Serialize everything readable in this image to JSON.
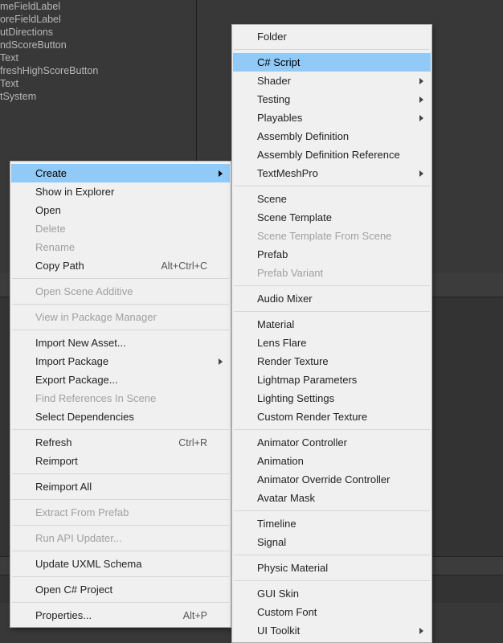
{
  "hierarchy": {
    "items": [
      "meFieldLabel",
      "oreFieldLabel",
      "utDirections",
      "ndScoreButton",
      "Text",
      "freshHighScoreButton",
      "Text",
      "tSystem"
    ]
  },
  "contextMenu": {
    "items": [
      {
        "label": "Create",
        "submenu": true,
        "highlight": true
      },
      {
        "label": "Show in Explorer"
      },
      {
        "label": "Open"
      },
      {
        "label": "Delete",
        "disabled": true
      },
      {
        "label": "Rename",
        "disabled": true
      },
      {
        "label": "Copy Path",
        "shortcut": "Alt+Ctrl+C"
      },
      {
        "sep": true
      },
      {
        "label": "Open Scene Additive",
        "disabled": true
      },
      {
        "sep": true
      },
      {
        "label": "View in Package Manager",
        "disabled": true
      },
      {
        "sep": true
      },
      {
        "label": "Import New Asset..."
      },
      {
        "label": "Import Package",
        "submenu": true
      },
      {
        "label": "Export Package..."
      },
      {
        "label": "Find References In Scene",
        "disabled": true
      },
      {
        "label": "Select Dependencies"
      },
      {
        "sep": true
      },
      {
        "label": "Refresh",
        "shortcut": "Ctrl+R"
      },
      {
        "label": "Reimport"
      },
      {
        "sep": true
      },
      {
        "label": "Reimport All"
      },
      {
        "sep": true
      },
      {
        "label": "Extract From Prefab",
        "disabled": true
      },
      {
        "sep": true
      },
      {
        "label": "Run API Updater...",
        "disabled": true
      },
      {
        "sep": true
      },
      {
        "label": "Update UXML Schema"
      },
      {
        "sep": true
      },
      {
        "label": "Open C# Project"
      },
      {
        "sep": true
      },
      {
        "label": "Properties...",
        "shortcut": "Alt+P"
      }
    ]
  },
  "createSubmenu": {
    "items": [
      {
        "label": "Folder"
      },
      {
        "sep": true
      },
      {
        "label": "C# Script",
        "highlight": true
      },
      {
        "label": "Shader",
        "submenu": true
      },
      {
        "label": "Testing",
        "submenu": true
      },
      {
        "label": "Playables",
        "submenu": true
      },
      {
        "label": "Assembly Definition"
      },
      {
        "label": "Assembly Definition Reference"
      },
      {
        "label": "TextMeshPro",
        "submenu": true
      },
      {
        "sep": true
      },
      {
        "label": "Scene"
      },
      {
        "label": "Scene Template"
      },
      {
        "label": "Scene Template From Scene",
        "disabled": true
      },
      {
        "label": "Prefab"
      },
      {
        "label": "Prefab Variant",
        "disabled": true
      },
      {
        "sep": true
      },
      {
        "label": "Audio Mixer"
      },
      {
        "sep": true
      },
      {
        "label": "Material"
      },
      {
        "label": "Lens Flare"
      },
      {
        "label": "Render Texture"
      },
      {
        "label": "Lightmap Parameters"
      },
      {
        "label": "Lighting Settings"
      },
      {
        "label": "Custom Render Texture"
      },
      {
        "sep": true
      },
      {
        "label": "Animator Controller"
      },
      {
        "label": "Animation"
      },
      {
        "label": "Animator Override Controller"
      },
      {
        "label": "Avatar Mask"
      },
      {
        "sep": true
      },
      {
        "label": "Timeline"
      },
      {
        "label": "Signal"
      },
      {
        "sep": true
      },
      {
        "label": "Physic Material"
      },
      {
        "sep": true
      },
      {
        "label": "GUI Skin"
      },
      {
        "label": "Custom Font"
      },
      {
        "label": "UI Toolkit",
        "submenu": true
      }
    ]
  }
}
